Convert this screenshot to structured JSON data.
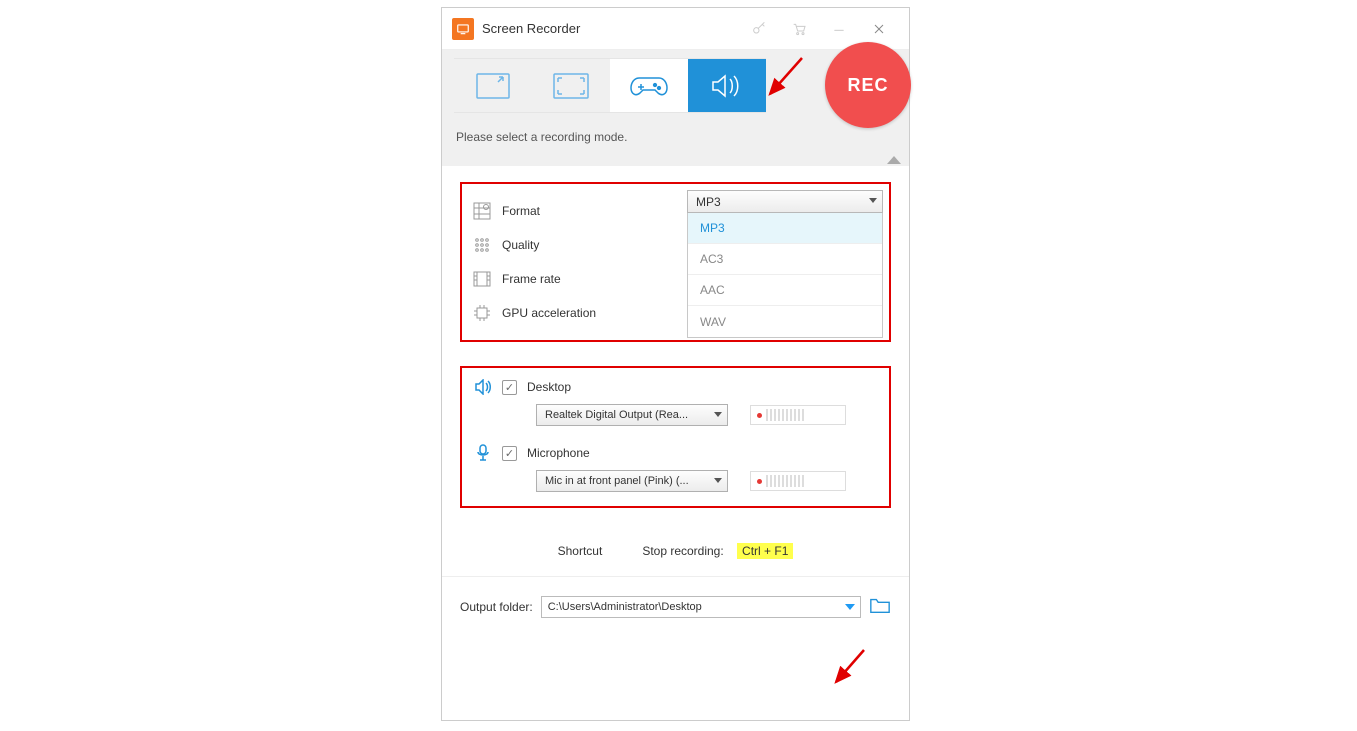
{
  "app": {
    "title": "Screen Recorder"
  },
  "rec": {
    "label": "REC"
  },
  "instruction": "Please select a recording mode.",
  "settings": {
    "format": {
      "label": "Format",
      "selected": "MP3",
      "options": [
        "MP3",
        "AC3",
        "AAC",
        "WAV"
      ]
    },
    "quality": {
      "label": "Quality"
    },
    "frame_rate": {
      "label": "Frame rate"
    },
    "gpu": {
      "label": "GPU acceleration"
    }
  },
  "audio": {
    "desktop": {
      "label": "Desktop",
      "device": "Realtek Digital Output (Rea..."
    },
    "microphone": {
      "label": "Microphone",
      "device": "Mic in at front panel (Pink) (..."
    }
  },
  "shortcut": {
    "label": "Shortcut",
    "action": "Stop recording:",
    "key": "Ctrl + F1"
  },
  "output": {
    "label": "Output folder:",
    "path": "C:\\Users\\Administrator\\Desktop"
  }
}
